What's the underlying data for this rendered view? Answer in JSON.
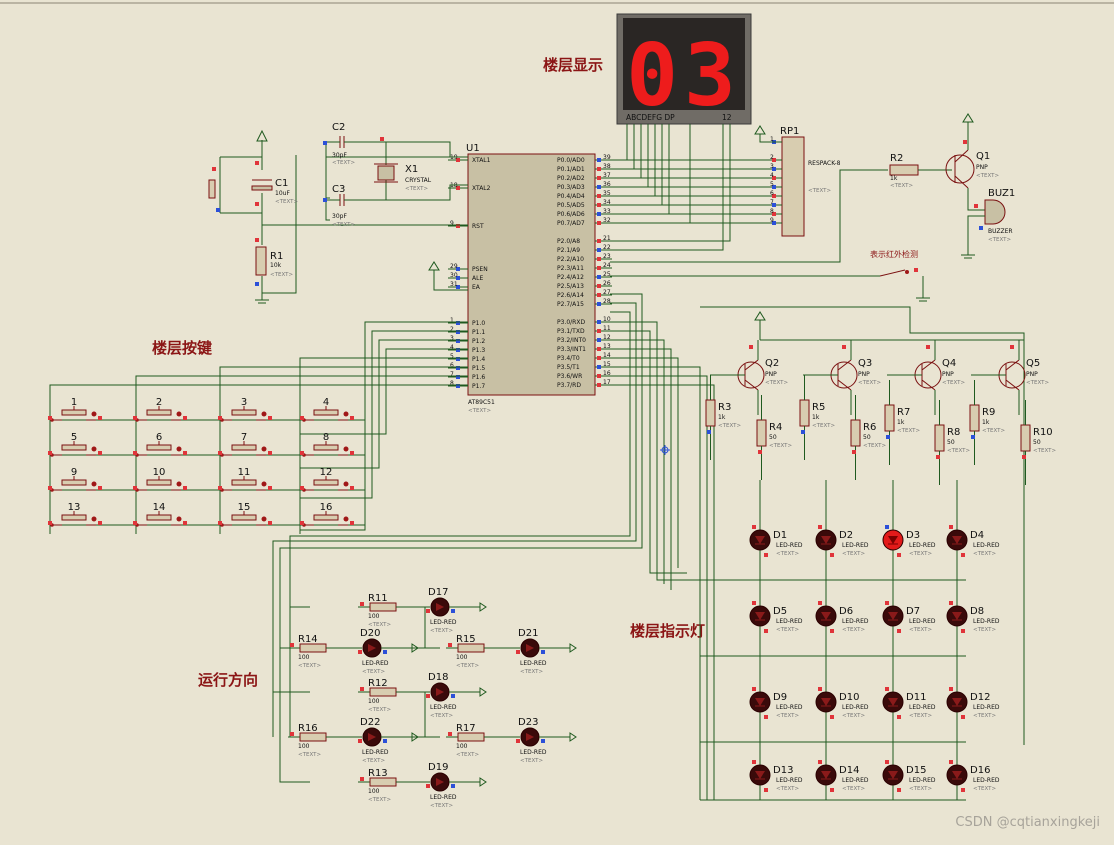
{
  "titles": {
    "floor_display": "楼层显示",
    "floor_buttons": "楼层按键",
    "run_direction": "运行方向",
    "floor_indicators": "楼层指示灯",
    "ir_detect": "表示红外检测"
  },
  "watermark": "CSDN @cqtianxingkeji",
  "display": {
    "digits": "03",
    "pin_label_left": "ABCDEFG DP",
    "pin_label_right": "12"
  },
  "mcu": {
    "ref": "U1",
    "part": "AT89C51",
    "text": "<TEXT>",
    "left_pins": [
      {
        "num": "19",
        "name": "XTAL1"
      },
      {
        "num": "18",
        "name": "XTAL2"
      },
      {
        "num": "9",
        "name": "RST"
      },
      {
        "num": "29",
        "name": "PSEN"
      },
      {
        "num": "30",
        "name": "ALE"
      },
      {
        "num": "31",
        "name": "EA"
      },
      {
        "num": "1",
        "name": "P1.0"
      },
      {
        "num": "2",
        "name": "P1.1"
      },
      {
        "num": "3",
        "name": "P1.2"
      },
      {
        "num": "4",
        "name": "P1.3"
      },
      {
        "num": "5",
        "name": "P1.4"
      },
      {
        "num": "6",
        "name": "P1.5"
      },
      {
        "num": "7",
        "name": "P1.6"
      },
      {
        "num": "8",
        "name": "P1.7"
      }
    ],
    "right_pins": [
      {
        "num": "39",
        "name": "P0.0/AD0"
      },
      {
        "num": "38",
        "name": "P0.1/AD1"
      },
      {
        "num": "37",
        "name": "P0.2/AD2"
      },
      {
        "num": "36",
        "name": "P0.3/AD3"
      },
      {
        "num": "35",
        "name": "P0.4/AD4"
      },
      {
        "num": "34",
        "name": "P0.5/AD5"
      },
      {
        "num": "33",
        "name": "P0.6/AD6"
      },
      {
        "num": "32",
        "name": "P0.7/AD7"
      },
      {
        "num": "21",
        "name": "P2.0/A8"
      },
      {
        "num": "22",
        "name": "P2.1/A9"
      },
      {
        "num": "23",
        "name": "P2.2/A10"
      },
      {
        "num": "24",
        "name": "P2.3/A11"
      },
      {
        "num": "25",
        "name": "P2.4/A12"
      },
      {
        "num": "26",
        "name": "P2.5/A13"
      },
      {
        "num": "27",
        "name": "P2.6/A14"
      },
      {
        "num": "28",
        "name": "P2.7/A15"
      },
      {
        "num": "10",
        "name": "P3.0/RXD"
      },
      {
        "num": "11",
        "name": "P3.1/TXD"
      },
      {
        "num": "12",
        "name": "P3.2/INT0"
      },
      {
        "num": "13",
        "name": "P3.3/INT1"
      },
      {
        "num": "14",
        "name": "P3.4/T0"
      },
      {
        "num": "15",
        "name": "P3.5/T1"
      },
      {
        "num": "16",
        "name": "P3.6/WR"
      },
      {
        "num": "17",
        "name": "P3.7/RD"
      }
    ]
  },
  "osc": {
    "c2": {
      "ref": "C2",
      "value": "30pF",
      "text": "<TEXT>"
    },
    "c3": {
      "ref": "C3",
      "value": "30pF",
      "text": "<TEXT>"
    },
    "x1": {
      "ref": "X1",
      "value": "CRYSTAL",
      "text": "<TEXT>"
    },
    "c1": {
      "ref": "C1",
      "value": "10uF",
      "text": "<TEXT>"
    },
    "r1": {
      "ref": "R1",
      "value": "10k",
      "text": "<TEXT>"
    }
  },
  "rp1": {
    "ref": "RP1",
    "part": "RESPACK-8",
    "text": "<TEXT>",
    "pins": [
      "1",
      "2",
      "3",
      "4",
      "5",
      "6",
      "7",
      "8",
      "9"
    ]
  },
  "buzzer_section": {
    "r2": {
      "ref": "R2",
      "value": "1k",
      "text": "<TEXT>"
    },
    "q1": {
      "ref": "Q1",
      "type": "PNP",
      "text": "<TEXT>"
    },
    "buz": {
      "ref": "BUZ1",
      "type": "BUZZER",
      "text": "<TEXT>"
    }
  },
  "keypad": [
    "1",
    "2",
    "3",
    "4",
    "5",
    "6",
    "7",
    "8",
    "9",
    "10",
    "11",
    "12",
    "13",
    "14",
    "15",
    "16"
  ],
  "transistors": [
    {
      "ref": "Q2",
      "type": "PNP",
      "text": "<TEXT>"
    },
    {
      "ref": "Q3",
      "type": "PNP",
      "text": "<TEXT>"
    },
    {
      "ref": "Q4",
      "type": "PNP",
      "text": "<TEXT>"
    },
    {
      "ref": "Q5",
      "type": "PNP",
      "text": "<TEXT>"
    }
  ],
  "drive_resistors": [
    {
      "ref": "R3",
      "value": "1k",
      "text": "<TEXT>"
    },
    {
      "ref": "R4",
      "value": "50",
      "text": "<TEXT>"
    },
    {
      "ref": "R5",
      "value": "1k",
      "text": "<TEXT>"
    },
    {
      "ref": "R6",
      "value": "50",
      "text": "<TEXT>"
    },
    {
      "ref": "R7",
      "value": "1k",
      "text": "<TEXT>"
    },
    {
      "ref": "R8",
      "value": "50",
      "text": "<TEXT>"
    },
    {
      "ref": "R9",
      "value": "1k",
      "text": "<TEXT>"
    },
    {
      "ref": "R10",
      "value": "50",
      "text": "<TEXT>"
    }
  ],
  "matrix_leds": [
    {
      "ref": "D1",
      "type": "LED-RED",
      "text": "<TEXT>",
      "lit": false
    },
    {
      "ref": "D2",
      "type": "LED-RED",
      "text": "<TEXT>",
      "lit": false
    },
    {
      "ref": "D3",
      "type": "LED-RED",
      "text": "<TEXT>",
      "lit": true
    },
    {
      "ref": "D4",
      "type": "LED-RED",
      "text": "<TEXT>",
      "lit": false
    },
    {
      "ref": "D5",
      "type": "LED-RED",
      "text": "<TEXT>",
      "lit": false
    },
    {
      "ref": "D6",
      "type": "LED-RED",
      "text": "<TEXT>",
      "lit": false
    },
    {
      "ref": "D7",
      "type": "LED-RED",
      "text": "<TEXT>",
      "lit": false
    },
    {
      "ref": "D8",
      "type": "LED-RED",
      "text": "<TEXT>",
      "lit": false
    },
    {
      "ref": "D9",
      "type": "LED-RED",
      "text": "<TEXT>",
      "lit": false
    },
    {
      "ref": "D10",
      "type": "LED-RED",
      "text": "<TEXT>",
      "lit": false
    },
    {
      "ref": "D11",
      "type": "LED-RED",
      "text": "<TEXT>",
      "lit": false
    },
    {
      "ref": "D12",
      "type": "LED-RED",
      "text": "<TEXT>",
      "lit": false
    },
    {
      "ref": "D13",
      "type": "LED-RED",
      "text": "<TEXT>",
      "lit": false
    },
    {
      "ref": "D14",
      "type": "LED-RED",
      "text": "<TEXT>",
      "lit": false
    },
    {
      "ref": "D15",
      "type": "LED-RED",
      "text": "<TEXT>",
      "lit": false
    },
    {
      "ref": "D16",
      "type": "LED-RED",
      "text": "<TEXT>",
      "lit": false
    }
  ],
  "direction_leds": [
    {
      "r": "R11",
      "rv": "100",
      "d": "D17"
    },
    {
      "r": "R14",
      "rv": "100",
      "d": "D20"
    },
    {
      "r": "R15",
      "rv": "100",
      "d": "D21"
    },
    {
      "r": "R12",
      "rv": "100",
      "d": "D18"
    },
    {
      "r": "R16",
      "rv": "100",
      "d": "D22"
    },
    {
      "r": "R17",
      "rv": "100",
      "d": "D23"
    },
    {
      "r": "R13",
      "rv": "100",
      "d": "D19"
    }
  ],
  "led_type": "LED-RED",
  "text_placeholder": "<TEXT>"
}
